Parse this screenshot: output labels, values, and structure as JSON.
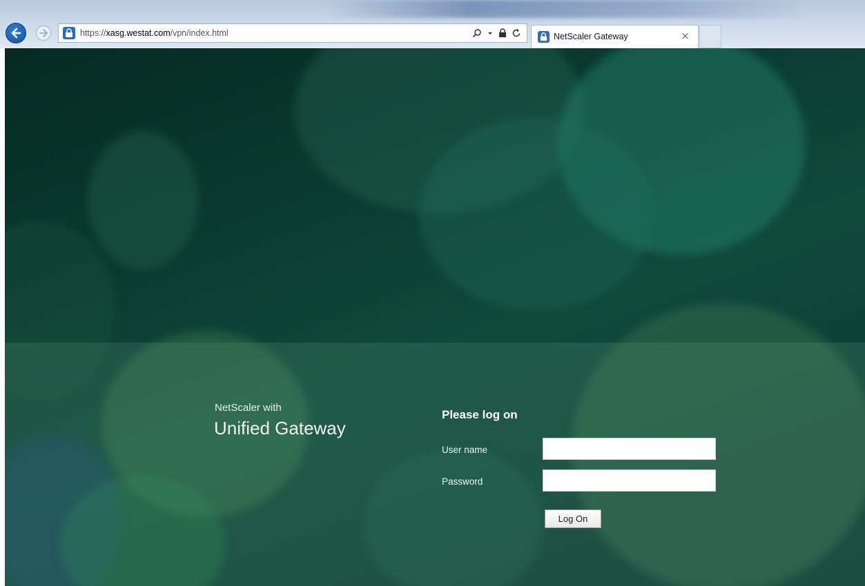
{
  "browser": {
    "url_scheme": "https://",
    "url_host": "xasg.westat.com",
    "url_path": "/vpn/index.html",
    "tab_title": "NetScaler Gateway",
    "tab_close_glyph": "×",
    "icons": {
      "back": "back-arrow-icon",
      "forward": "forward-arrow-icon",
      "site": "lock-site-icon",
      "search": "search-icon",
      "dropdown": "dropdown-caret-icon",
      "lock": "lock-icon",
      "refresh": "refresh-icon",
      "close": "close-icon"
    }
  },
  "page": {
    "brand_line1": "NetScaler with",
    "brand_line2": "Unified Gateway",
    "login": {
      "heading": "Please log on",
      "username_label": "User name",
      "username_value": "",
      "password_label": "Password",
      "password_value": "",
      "button_label": "Log On"
    },
    "colors": {
      "background_dark": "#062a22",
      "background_mid": "#0f4a3b",
      "accent_browser": "#1a5fae"
    }
  }
}
